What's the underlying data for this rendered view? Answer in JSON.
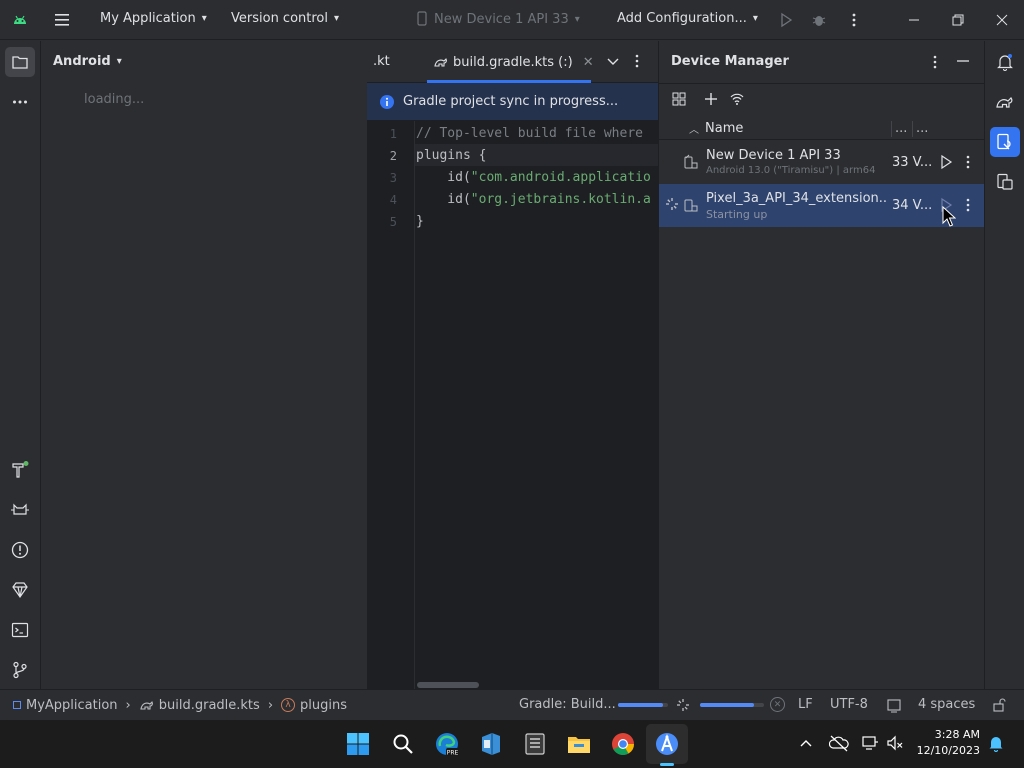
{
  "titlebar": {
    "project": "My Application",
    "vcs": "Version control",
    "device": "New Device 1 API 33",
    "config": "Add Configuration..."
  },
  "project_panel": {
    "view": "Android",
    "loading": "loading..."
  },
  "editor": {
    "tab_prev": ".kt",
    "tab_active": "build.gradle.kts (:)",
    "banner": "Gradle project sync in progress...",
    "line_numbers": [
      "1",
      "2",
      "3",
      "4",
      "5"
    ],
    "lines": {
      "l1": "// Top-level build file where",
      "l2": "plugins {",
      "l3_pre": "    id(",
      "l3_str": "\"com.android.applicatio",
      "l4_pre": "    id(",
      "l4_str": "\"org.jetbrains.kotlin.a",
      "l5": "}"
    }
  },
  "device_manager": {
    "title": "Device Manager",
    "column_name": "Name",
    "col_more1": "...",
    "col_more2": "...",
    "devices": [
      {
        "name": "New Device 1 API 33",
        "sub": "Android 13.0 (\"Tiramisu\") | arm64",
        "api": "33 V..."
      },
      {
        "name": "Pixel_3a_API_34_extension...",
        "sub": "Starting up",
        "api": "34 V..."
      }
    ]
  },
  "statusbar": {
    "crumb_project": "MyApplication",
    "crumb_file": "build.gradle.kts",
    "crumb_symbol": "plugins",
    "gradle": "Gradle: Build...",
    "progress1": 0.9,
    "progress2": 0.85,
    "line_sep": "LF",
    "encoding": "UTF-8",
    "indent": "4 spaces"
  },
  "taskbar": {
    "time": "3:28 AM",
    "date": "12/10/2023"
  },
  "colors": {
    "selection": "#2e436e",
    "accent": "#3574f0",
    "success": "#5fb865"
  }
}
